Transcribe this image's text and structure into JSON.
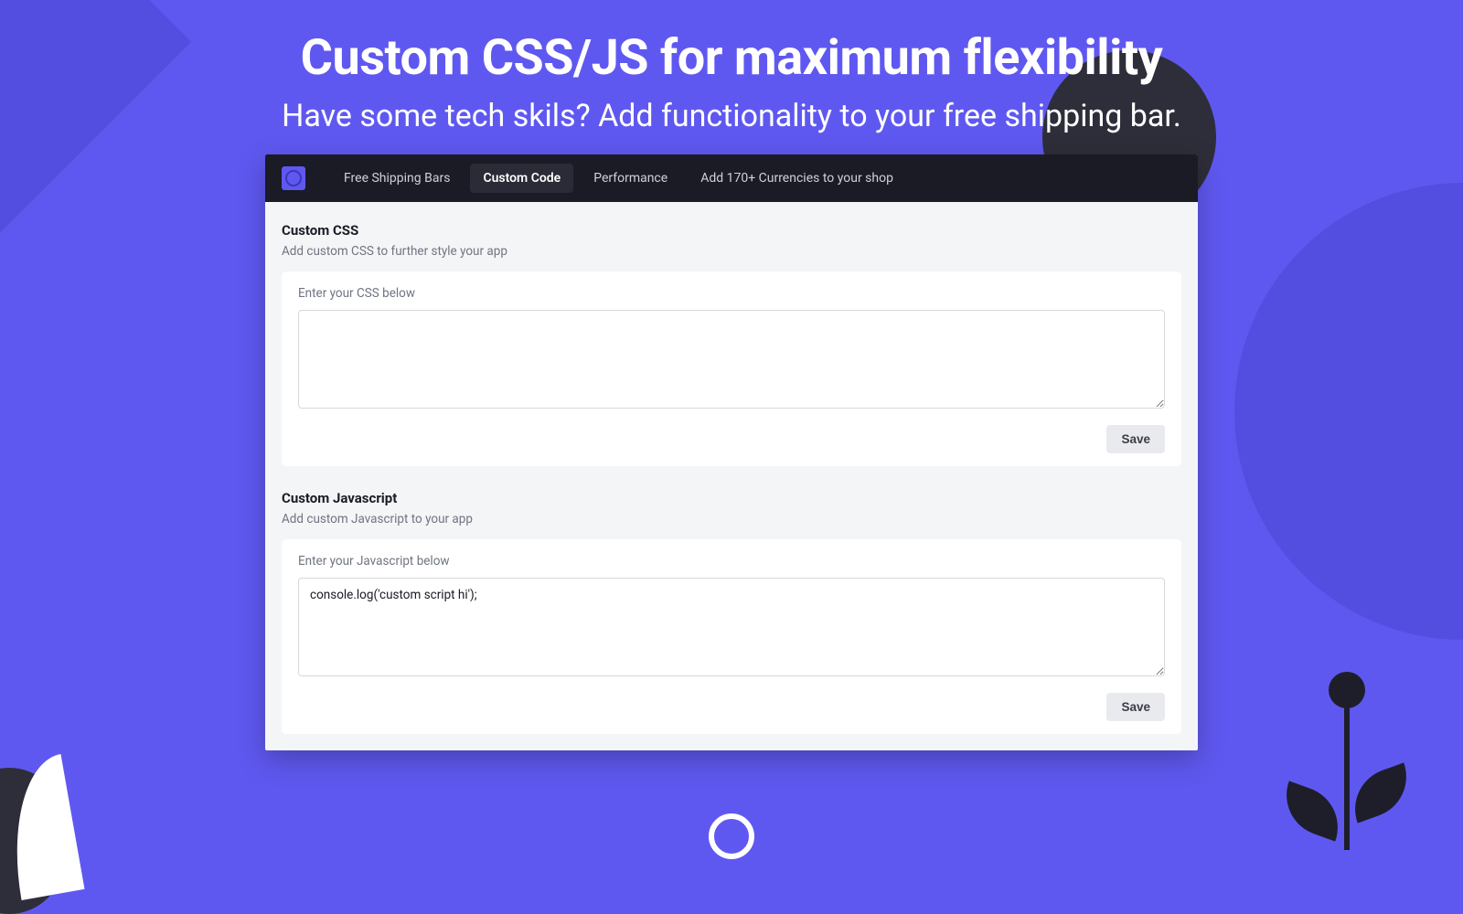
{
  "hero": {
    "title": "Custom CSS/JS for maximum flexibility",
    "subtitle": "Have some tech skils? Add functionality to your free shipping bar."
  },
  "nav": {
    "items": [
      {
        "label": "Free Shipping Bars",
        "active": false
      },
      {
        "label": "Custom Code",
        "active": true
      },
      {
        "label": "Performance",
        "active": false
      },
      {
        "label": "Add 170+ Currencies to your shop",
        "active": false
      }
    ]
  },
  "css_section": {
    "heading": "Custom CSS",
    "sub": "Add custom CSS to further style your app",
    "label": "Enter your CSS below",
    "value": "",
    "save_label": "Save"
  },
  "js_section": {
    "heading": "Custom Javascript",
    "sub": "Add custom Javascript to your app",
    "label": "Enter your Javascript below",
    "value": "console.log('custom script hi');",
    "save_label": "Save"
  }
}
